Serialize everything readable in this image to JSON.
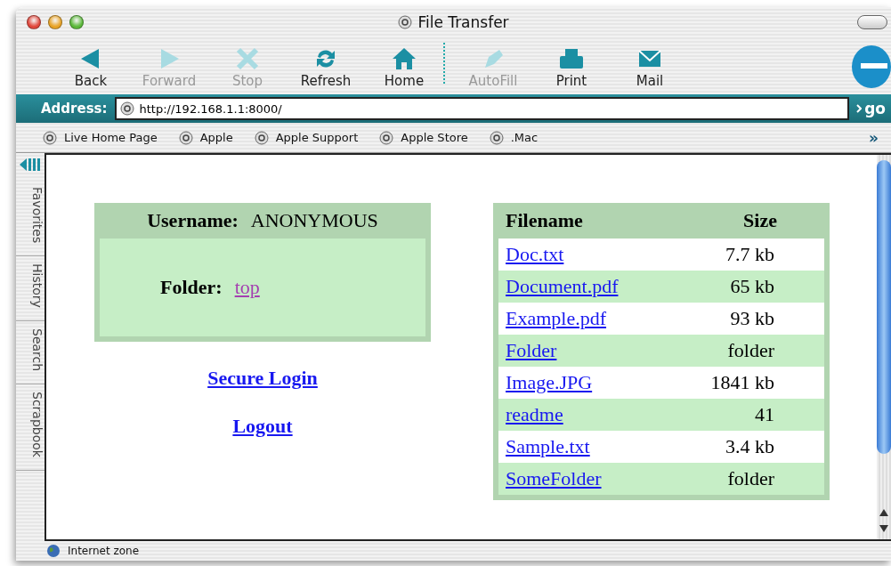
{
  "window": {
    "title": "File Transfer"
  },
  "toolbar": [
    {
      "kind": "back",
      "label": "Back",
      "disabled": false
    },
    {
      "kind": "forward",
      "label": "Forward",
      "disabled": true
    },
    {
      "kind": "stop",
      "label": "Stop",
      "disabled": true
    },
    {
      "kind": "refresh",
      "label": "Refresh",
      "disabled": false
    },
    {
      "kind": "home",
      "label": "Home",
      "disabled": false
    },
    {
      "kind": "autofill",
      "label": "AutoFill",
      "disabled": true
    },
    {
      "kind": "print",
      "label": "Print",
      "disabled": false
    },
    {
      "kind": "mail",
      "label": "Mail",
      "disabled": false
    }
  ],
  "address_bar": {
    "label": "Address:",
    "value": "http://192.168.1.1:8000/",
    "go": "go"
  },
  "favorites_bar": {
    "items": [
      "Live Home Page",
      "Apple",
      "Apple Support",
      "Apple Store",
      ".Mac"
    ],
    "more": "»"
  },
  "sidebar_tabs": [
    "Favorites",
    "History",
    "Search",
    "Scrapbook"
  ],
  "user_panel": {
    "username_label": "Username:",
    "username": "ANONYMOUS",
    "folder_label": "Folder:",
    "folder": "top"
  },
  "links": [
    "Secure Login",
    "Logout"
  ],
  "file_table": {
    "columns": [
      "Filename",
      "Size"
    ],
    "rows": [
      {
        "name": "Doc.txt",
        "size": "7.7 kb"
      },
      {
        "name": "Document.pdf",
        "size": "65 kb"
      },
      {
        "name": "Example.pdf",
        "size": "93 kb"
      },
      {
        "name": "Folder",
        "size": "folder"
      },
      {
        "name": "Image.JPG",
        "size": "1841 kb"
      },
      {
        "name": "readme",
        "size": "41"
      },
      {
        "name": "Sample.txt",
        "size": "3.4 kb"
      },
      {
        "name": "SomeFolder",
        "size": "folder"
      }
    ]
  },
  "status_bar": {
    "zone": "Internet zone"
  }
}
